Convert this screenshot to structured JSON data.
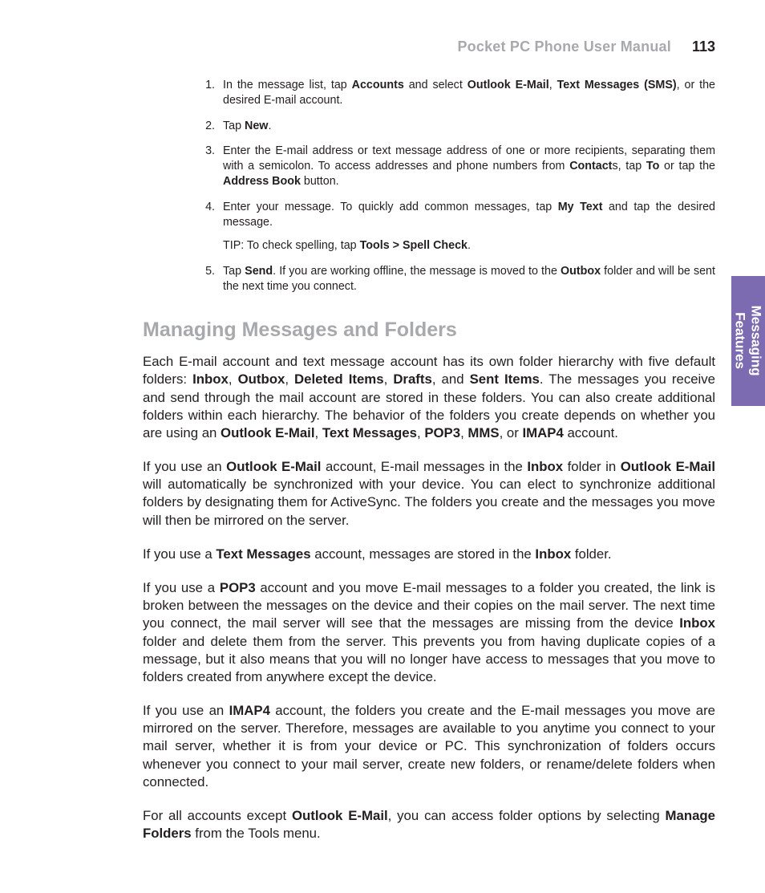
{
  "header": {
    "title": "Pocket PC Phone User Manual",
    "page_number": "113"
  },
  "side_tab": {
    "line1": "Messaging",
    "line2": "Features"
  },
  "steps": {
    "s1": {
      "pre": "In the message list, tap ",
      "b1": "Accounts",
      "mid1": " and select ",
      "b2": "Outlook E-Mail",
      "sep1": ", ",
      "b3": "Text Messages (SMS)",
      "post": ", or the desired E-mail account."
    },
    "s2": {
      "pre": "Tap ",
      "b1": "New",
      "post": "."
    },
    "s3": {
      "pre": "Enter the E-mail address or text message address of one or more recipients, separating them with a semicolon.  To access addresses and phone numbers from ",
      "b1": "Contact",
      "mid1": "s, tap ",
      "b2": "To",
      "mid2": " or tap the ",
      "b3": "Address Book",
      "post": " button."
    },
    "s4": {
      "pre": "Enter your message.  To quickly add common messages, tap ",
      "b1": "My Text",
      "post": " and tap the desired message.",
      "tip_pre": "TIP:   To check spelling, tap ",
      "tip_b": "Tools > Spell Check",
      "tip_post": "."
    },
    "s5": {
      "pre": "Tap ",
      "b1": "Send",
      "mid1": ".  If you are working offline, the message is moved to the ",
      "b2": "Outbox",
      "post": " folder and will be sent the next time you connect."
    }
  },
  "section_title": "Managing Messages and Folders",
  "paras": {
    "p1": {
      "t1": "Each E-mail account and text message account has its own folder hierarchy with five default folders:  ",
      "b1": "Inbox",
      "c1": ", ",
      "b2": "Outbox",
      "c2": ", ",
      "b3": "Deleted Items",
      "c3": ", ",
      "b4": "Drafts",
      "c4": ", and ",
      "b5": "Sent Items",
      "t2": ".  The messages you receive and send through the mail account are stored in these folders.  You can also create additional folders within each hierarchy.  The behavior of the folders you create depends on whether you are using an ",
      "b6": "Outlook E-Mail",
      "c6": ", ",
      "b7": "Text Messages",
      "c7": ", ",
      "b8": "POP3",
      "c8": ", ",
      "b9": "MMS",
      "c9": ", or ",
      "b10": "IMAP4",
      "t3": " account."
    },
    "p2": {
      "t1": "If you use an ",
      "b1": "Outlook E-Mail",
      "t2": " account, E-mail messages in the ",
      "b2": "Inbox",
      "t3": " folder in ",
      "b3": "Outlook E-Mail",
      "t4": " will automatically be synchronized with your device.  You can elect to synchronize additional folders by designating them for ActiveSync.  The folders you create and the messages you move will then be mirrored on the server."
    },
    "p3": {
      "t1": "If you use a ",
      "b1": "Text Messages",
      "t2": " account, messages are stored in the ",
      "b2": "Inbox",
      "t3": " folder."
    },
    "p4": {
      "t1": "If you use a ",
      "b1": "POP3",
      "t2": " account and you move E-mail messages to a folder you created, the link is broken between the messages on the device and their copies on the mail server.  The next time you connect, the mail server will see that the messages are missing from the device ",
      "b2": "Inbox",
      "t3": " folder and delete them from the server.  This prevents you from having duplicate copies of a message, but it also means that you will no longer have access to messages that you move to folders created from anywhere except the device."
    },
    "p5": {
      "t1": "If you use an ",
      "b1": "IMAP4",
      "t2": " account, the folders you create and the E-mail messages you move are mirrored on the server.  Therefore, messages are available to you anytime you connect to your mail server, whether it is from your device or PC.  This synchronization of folders occurs whenever you connect to your mail server, create new folders, or rename/delete folders when connected."
    },
    "p6": {
      "t1": "For all accounts except ",
      "b1": "Outlook E-Mail",
      "t2": ", you can access folder options by selecting ",
      "b2": "Manage Folders",
      "t3": " from the Tools menu."
    }
  }
}
